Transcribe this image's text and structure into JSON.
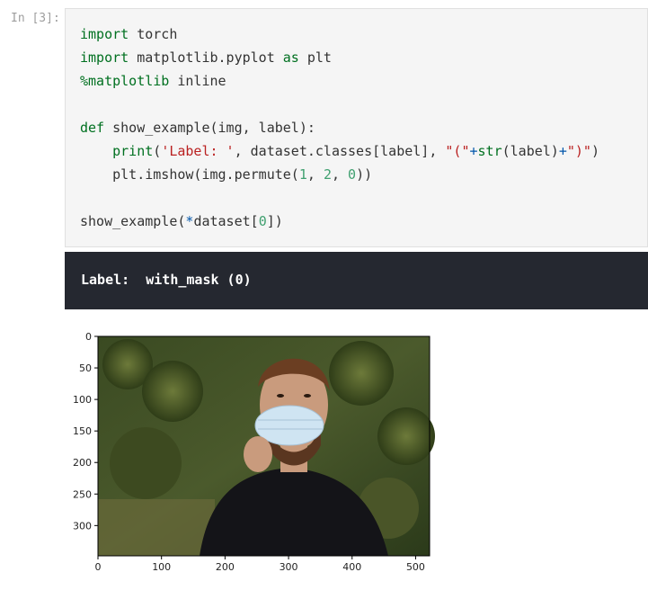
{
  "prompt": "In [3]:",
  "code_lines": [
    {
      "segments": [
        {
          "t": "import",
          "c": "kw"
        },
        {
          "t": " torch",
          "c": ""
        }
      ]
    },
    {
      "segments": [
        {
          "t": "import",
          "c": "kw"
        },
        {
          "t": " matplotlib.pyplot ",
          "c": ""
        },
        {
          "t": "as",
          "c": "kw"
        },
        {
          "t": " plt",
          "c": ""
        }
      ]
    },
    {
      "segments": [
        {
          "t": "%matplotlib",
          "c": "kw"
        },
        {
          "t": " inline",
          "c": ""
        }
      ]
    },
    {
      "segments": []
    },
    {
      "segments": [
        {
          "t": "def",
          "c": "kw"
        },
        {
          "t": " show_example(img, label):",
          "c": ""
        }
      ]
    },
    {
      "segments": [
        {
          "t": "    ",
          "c": ""
        },
        {
          "t": "print",
          "c": "kw"
        },
        {
          "t": "(",
          "c": ""
        },
        {
          "t": "'Label: '",
          "c": "str"
        },
        {
          "t": ", dataset.classes[label], ",
          "c": ""
        },
        {
          "t": "\"(\"",
          "c": "str"
        },
        {
          "t": "+",
          "c": "op"
        },
        {
          "t": "str",
          "c": "kw"
        },
        {
          "t": "(label)",
          "c": ""
        },
        {
          "t": "+",
          "c": "op"
        },
        {
          "t": "\")\"",
          "c": "str"
        },
        {
          "t": ")",
          "c": ""
        }
      ]
    },
    {
      "segments": [
        {
          "t": "    plt.imshow(img.permute(",
          "c": ""
        },
        {
          "t": "1",
          "c": "num"
        },
        {
          "t": ", ",
          "c": ""
        },
        {
          "t": "2",
          "c": "num"
        },
        {
          "t": ", ",
          "c": ""
        },
        {
          "t": "0",
          "c": "num"
        },
        {
          "t": "))",
          "c": ""
        }
      ]
    },
    {
      "segments": []
    },
    {
      "segments": [
        {
          "t": "show_example(",
          "c": ""
        },
        {
          "t": "*",
          "c": "op"
        },
        {
          "t": "dataset[",
          "c": ""
        },
        {
          "t": "0",
          "c": "num"
        },
        {
          "t": "])",
          "c": ""
        }
      ]
    }
  ],
  "output_text": "Label:  with_mask (0)",
  "plot": {
    "x_ticks": [
      "0",
      "100",
      "200",
      "300",
      "400",
      "500"
    ],
    "y_ticks": [
      "0",
      "50",
      "100",
      "150",
      "200",
      "250",
      "300"
    ],
    "image_content": "man wearing surgical face mask"
  }
}
